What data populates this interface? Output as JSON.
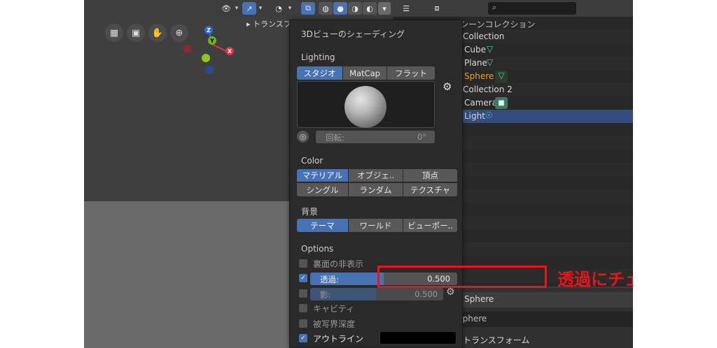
{
  "popup": {
    "title": "3Dビューのシェーディング",
    "lighting": {
      "heading": "Lighting",
      "options": [
        "スタジオ",
        "MatCap",
        "フラット"
      ],
      "rotation_label": "回転:",
      "rotation_value": "0°"
    },
    "color": {
      "heading": "Color",
      "options_row1": [
        "マテリアル",
        "オブジェ..",
        "頂点"
      ],
      "options_row2": [
        "シングル",
        "ランダム",
        "テクスチャ"
      ]
    },
    "background": {
      "heading": "背景",
      "options": [
        "テーマ",
        "ワールド",
        "ビューポー.."
      ]
    },
    "options": {
      "heading": "Options",
      "backface_label": "裏面の非表示",
      "xray_label": "透過:",
      "xray_value": "0.500",
      "xray_fraction": 0.5,
      "xray_checked": true,
      "shadow_label": "影:",
      "shadow_value": "0.500",
      "cavity_label": "キャビティ",
      "dof_label": "被写界深度",
      "outline_label": "アウトライン",
      "outline_checked": true
    }
  },
  "viewport": {
    "transform_tab": "トランスフォーム",
    "axes": {
      "z": "Z",
      "y": "Y",
      "x": "X"
    }
  },
  "outliner": {
    "title": "シーンコレクション",
    "items": [
      "Collection",
      "Cube",
      "Plane",
      "Sphere",
      "Collection 2",
      "Camera",
      "Light"
    ]
  },
  "properties": {
    "object_name": "Sphere",
    "data_name": "Sphere",
    "section": "トランスフォーム"
  },
  "annotation": {
    "text": "透過にチェック",
    "color": "#e8151c"
  },
  "colors": {
    "accent": "#4772b3",
    "selected_row": "#334d80",
    "active_item": "#e8a33c",
    "mesh_icon": "#4fd39e"
  }
}
